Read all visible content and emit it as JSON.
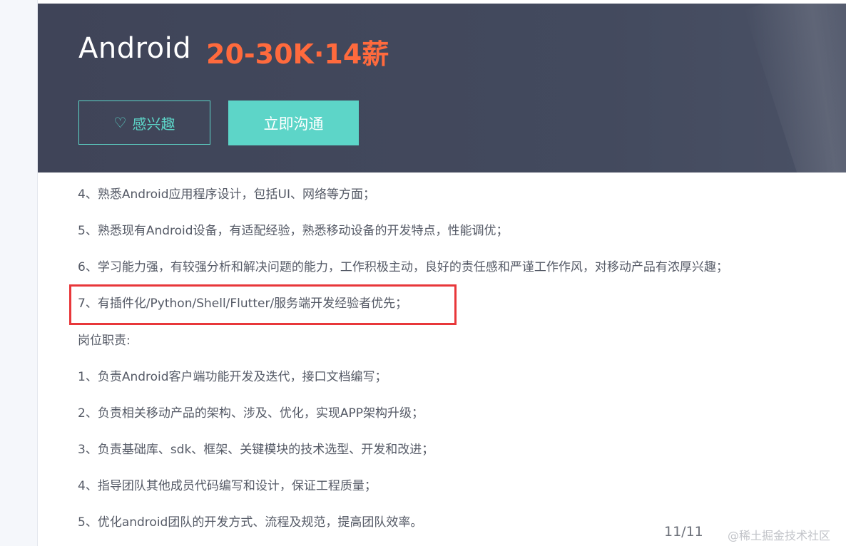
{
  "job": {
    "title": "Android",
    "salary": "20-30K·14薪"
  },
  "actions": {
    "interest_label": "感兴趣",
    "interest_icon": "heart-icon",
    "chat_label": "立即沟通"
  },
  "requirements": [
    "4、熟悉Android应用程序设计，包括UI、网络等方面；",
    "5、熟悉现有Android设备，有适配经验，熟悉移动设备的开发特点，性能调优；",
    "6、学习能力强，有较强分析和解决问题的能力，工作积极主动，良好的责任感和严谨工作作风，对移动产品有浓厚兴趣；",
    "7、有插件化/Python/Shell/Flutter/服务端开发经验者优先；"
  ],
  "duties_heading": "岗位职责:",
  "duties": [
    "1、负责Android客户端功能开发及迭代，接口文档编写；",
    "2、负责相关移动产品的架构、涉及、优化，实现APP架构升级；",
    "3、负责基础库、sdk、框架、关键模块的技术选型、开发和改进；",
    "4、指导团队其他成员代码编写和设计，保证工程质量；",
    "5、优化android团队的开发方式、流程及规范，提高团队效率。"
  ],
  "page_counter": "11/11",
  "watermark": "@稀土掘金技术社区",
  "colors": {
    "header_bg": "#434a5e",
    "salary": "#ff6a3d",
    "accent": "#5dd5c8",
    "highlight": "#e8373a"
  }
}
